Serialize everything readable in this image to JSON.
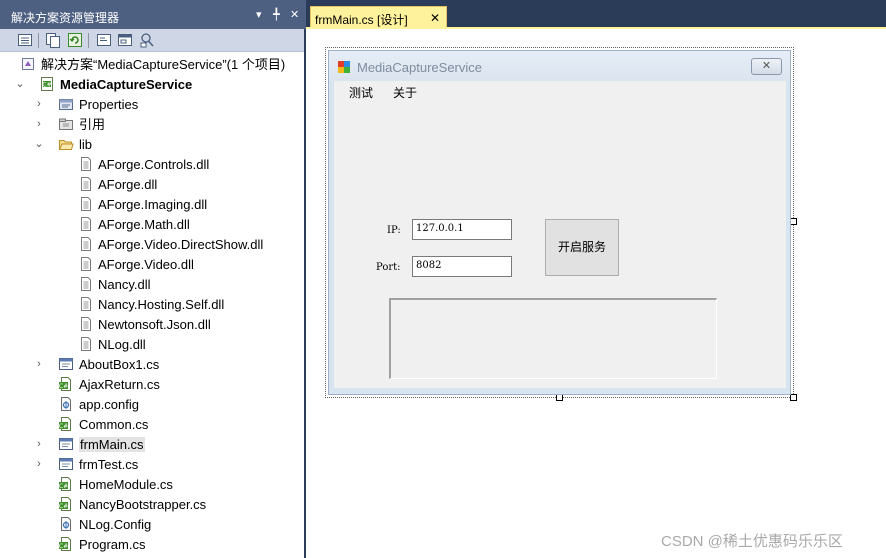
{
  "solution_explorer": {
    "title": "解决方案资源管理器",
    "title_icons": {
      "dropdown": "▾",
      "pin": "╇",
      "close": "✕"
    },
    "toolbar_buttons": [
      "properties",
      "show-all-files",
      "refresh",
      "view-code",
      "view-designer",
      "class-diagram"
    ],
    "tree": {
      "solution_label": "解决方案“MediaCaptureService”(1 个项目)",
      "project_label": "MediaCaptureService",
      "properties_label": "Properties",
      "references_label": "引用",
      "lib_label": "lib",
      "lib_files": [
        "AForge.Controls.dll",
        "AForge.dll",
        "AForge.Imaging.dll",
        "AForge.Math.dll",
        "AForge.Video.DirectShow.dll",
        "AForge.Video.dll",
        "Nancy.dll",
        "Nancy.Hosting.Self.dll",
        "Newtonsoft.Json.dll",
        "NLog.dll"
      ],
      "project_files": [
        {
          "label": "AboutBox1.cs",
          "icon": "form",
          "expandable": true,
          "selected": false
        },
        {
          "label": "AjaxReturn.cs",
          "icon": "csharp",
          "expandable": false,
          "selected": false
        },
        {
          "label": "app.config",
          "icon": "config",
          "expandable": false,
          "selected": false
        },
        {
          "label": "Common.cs",
          "icon": "csharp",
          "expandable": false,
          "selected": false
        },
        {
          "label": "frmMain.cs",
          "icon": "form",
          "expandable": true,
          "selected": true
        },
        {
          "label": "frmTest.cs",
          "icon": "form",
          "expandable": true,
          "selected": false
        },
        {
          "label": "HomeModule.cs",
          "icon": "csharp",
          "expandable": false,
          "selected": false
        },
        {
          "label": "NancyBootstrapper.cs",
          "icon": "csharp",
          "expandable": false,
          "selected": false
        },
        {
          "label": "NLog.Config",
          "icon": "config",
          "expandable": false,
          "selected": false
        },
        {
          "label": "Program.cs",
          "icon": "csharp",
          "expandable": false,
          "selected": false
        }
      ]
    }
  },
  "document_tab": {
    "label": "frmMain.cs [设计]",
    "close": "✕"
  },
  "form": {
    "caption": "MediaCaptureService",
    "close_glyph": "✕",
    "menu": [
      "测试",
      "关于"
    ],
    "ip_label": "IP:",
    "ip_value": "127.0.0.1",
    "port_label": "Port:",
    "port_value": "8082",
    "start_button": "开启服务"
  },
  "watermark": "CSDN @稀土优惠码乐乐区",
  "colors": {
    "title_bar": "#4d6082",
    "toolbar": "#cfd6e5",
    "tab_strip": "#2b3c59",
    "active_tab": "#fff29d",
    "form_frame": "#d9e4f1",
    "form_client": "#f0f0f0"
  }
}
